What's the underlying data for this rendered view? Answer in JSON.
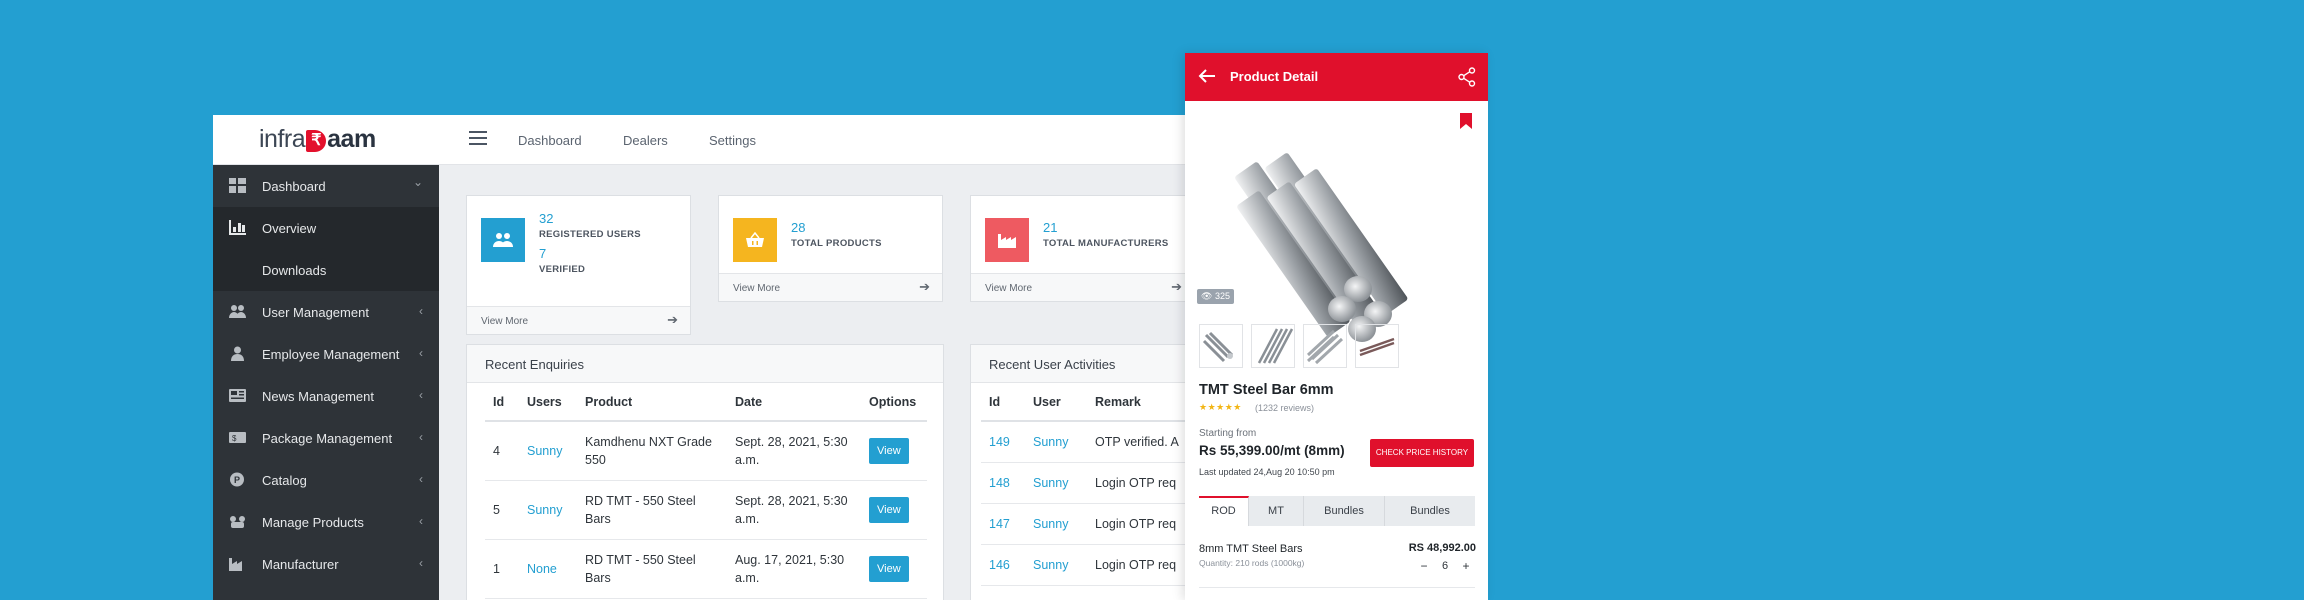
{
  "header": {
    "logo_left": "infra",
    "logo_rupee": "₹",
    "logo_right": "aam",
    "nav": [
      "Dashboard",
      "Dealers",
      "Settings"
    ]
  },
  "sidebar": {
    "items": [
      {
        "label": "Dashboard",
        "icon": "grid-icon"
      },
      {
        "label": "Overview",
        "icon": "bar-chart-icon"
      },
      {
        "label": "Downloads",
        "icon": ""
      },
      {
        "label": "User Management",
        "icon": "users-icon"
      },
      {
        "label": "Employee Management",
        "icon": "employee-icon"
      },
      {
        "label": "News Management",
        "icon": "newspaper-icon"
      },
      {
        "label": "Package Management",
        "icon": "package-icon"
      },
      {
        "label": "Catalog",
        "icon": "catalog-icon"
      },
      {
        "label": "Manage Products",
        "icon": "products-icon"
      },
      {
        "label": "Manufacturer",
        "icon": "factory-icon"
      }
    ],
    "chev_down": "⌄",
    "chev_left": "‹"
  },
  "stats": {
    "users": {
      "count": "32",
      "label": "REGISTERED USERS",
      "count2": "7",
      "label2": "VERIFIED",
      "color": "#239fd1"
    },
    "products": {
      "count": "28",
      "label": "TOTAL PRODUCTS",
      "color": "#f5b51f"
    },
    "manufacturers": {
      "count": "21",
      "label": "TOTAL MANUFACTURERS",
      "color": "#ee5a61"
    },
    "view_more": "View More",
    "arrow": "➔"
  },
  "enquiries": {
    "title": "Recent Enquiries",
    "columns": [
      "Id",
      "Users",
      "Product",
      "Date",
      "Options"
    ],
    "rows": [
      {
        "id": "4",
        "user": "Sunny",
        "product": "Kamdhenu NXT Grade 550",
        "date": "Sept. 28, 2021, 5:30 a.m.",
        "option": "View"
      },
      {
        "id": "5",
        "user": "Sunny",
        "product": "RD TMT - 550 Steel Bars",
        "date": "Sept. 28, 2021, 5:30 a.m.",
        "option": "View"
      },
      {
        "id": "1",
        "user": "None",
        "product": "RD TMT - 550 Steel Bars",
        "date": "Aug. 17, 2021, 5:30 a.m.",
        "option": "View"
      }
    ]
  },
  "activities": {
    "title": "Recent User Activities",
    "columns": [
      "Id",
      "User",
      "Remark"
    ],
    "rows": [
      {
        "id": "149",
        "user": "Sunny",
        "remark": "OTP verified. A"
      },
      {
        "id": "148",
        "user": "Sunny",
        "remark": "Login OTP req"
      },
      {
        "id": "147",
        "user": "Sunny",
        "remark": "Login OTP req"
      },
      {
        "id": "146",
        "user": "Sunny",
        "remark": "Login OTP req"
      }
    ]
  },
  "product": {
    "header_title": "Product Detail",
    "views": "325",
    "name": "TMT Steel Bar 6mm",
    "stars": "★★★★★",
    "reviews": "(1232 reviews)",
    "starting_from": "Starting from",
    "price": "Rs 55,399.00/mt (8mm)",
    "last_updated": "Last updated 24,Aug 20 10:50 pm",
    "check_price_btn": "CHECK PRICE HISTORY",
    "tabs": [
      "ROD",
      "MT",
      "Bundles",
      "Bundles"
    ],
    "active_tab": "ROD",
    "variant": {
      "name": "8mm TMT Steel Bars",
      "quantity": "Quantity: 210 rods (1000kg)",
      "price": "RS 48,992.00",
      "qty_value": "6",
      "minus": "−",
      "plus": "+"
    },
    "brand_color": "#e0102c"
  }
}
